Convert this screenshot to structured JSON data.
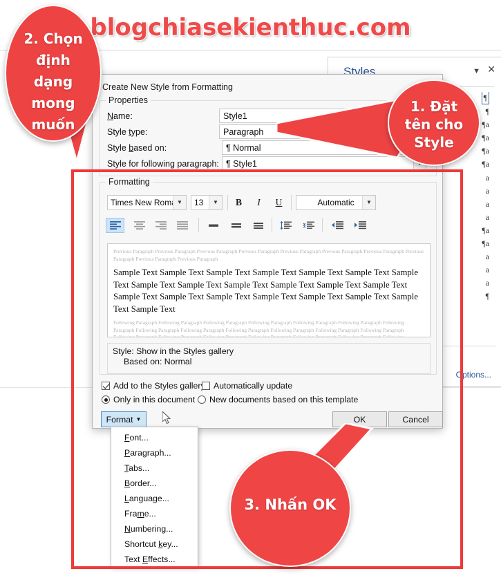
{
  "watermark": "blogchiasekienthuc.com",
  "styles_pane": {
    "title": "Styles",
    "caret_icon": "chevron-down-icon",
    "close_icon": "close-icon",
    "options_label": "Options...",
    "items": [
      {
        "mark": "¶",
        "selected": true
      },
      {
        "mark": "¶",
        "selected": false
      },
      {
        "mark": "¶a",
        "selected": false
      },
      {
        "mark": "¶a",
        "selected": false
      },
      {
        "mark": "¶a",
        "selected": false
      },
      {
        "mark": "¶a",
        "selected": false
      },
      {
        "mark": "a",
        "selected": false
      },
      {
        "mark": "a",
        "selected": false
      },
      {
        "mark": "a",
        "selected": false
      },
      {
        "mark": "a",
        "selected": false
      },
      {
        "mark": "¶a",
        "selected": false
      },
      {
        "mark": "¶a",
        "selected": false
      },
      {
        "mark": "a",
        "selected": false
      },
      {
        "mark": "a",
        "selected": false
      },
      {
        "mark": "a",
        "selected": false
      },
      {
        "mark": "¶",
        "selected": false
      }
    ]
  },
  "dialog": {
    "title": "Create New Style from Formatting",
    "close_icon": "close-icon",
    "properties": {
      "legend": "Properties",
      "name_label": "Name:",
      "name_value": "Style1",
      "style_type_label": "Style type:",
      "style_type_value": "Paragraph",
      "style_based_on_label": "Style based on:",
      "style_based_on_value": "¶ Normal",
      "style_following_label": "Style for following paragraph:",
      "style_following_value": "¶ Style1"
    },
    "formatting": {
      "legend": "Formatting",
      "font_family": "Times New Roman",
      "font_size": "13",
      "bold": "B",
      "italic": "I",
      "underline": "U",
      "font_color": "Automatic",
      "align_buttons": [
        "align-left",
        "align-center",
        "align-right",
        "align-justify"
      ],
      "spacing_buttons": [
        "line-spacing-single",
        "line-spacing-1.5",
        "line-spacing-double"
      ],
      "para_spacing_buttons": [
        "increase-paragraph-spacing",
        "decrease-paragraph-spacing"
      ],
      "indent_buttons": [
        "decrease-indent",
        "increase-indent"
      ],
      "preview": {
        "previous_paragraph": "Previous Paragraph Previous Paragraph Previous Paragraph Previous Paragraph Previous Paragraph Previous Paragraph Previous Paragraph Previous Paragraph Previous Paragraph Previous Paragraph",
        "sample_text": "Sample Text Sample Text Sample Text Sample Text Sample Text Sample Text Sample Text Sample Text Sample Text Sample Text Sample Text Sample Text Sample Text Sample Text Sample Text Sample Text Sample Text Sample Text Sample Text Sample Text Sample Text",
        "following_paragraph": "Following Paragraph Following Paragraph Following Paragraph Following Paragraph Following Paragraph Following Paragraph Following Paragraph Following Paragraph Following Paragraph Following Paragraph Following Paragraph Following Paragraph Following Paragraph Following Paragraph Following Paragraph Following Paragraph Following Paragraph Following Paragraph Following Paragraph Following Paragraph"
      },
      "description_line1": "Style: Show in the Styles gallery",
      "description_line2": "Based on: Normal"
    },
    "options": {
      "add_to_gallery_label": "Add to the Styles gallery",
      "add_to_gallery_checked": true,
      "auto_update_label": "Automatically update",
      "auto_update_checked": false,
      "only_this_doc_label": "Only in this document",
      "only_this_doc_selected": true,
      "new_docs_label": "New documents based on this template",
      "new_docs_selected": false
    },
    "buttons": {
      "format_label": "Format",
      "ok_label": "OK",
      "cancel_label": "Cancel"
    }
  },
  "format_menu": {
    "items": [
      "Font...",
      "Paragraph...",
      "Tabs...",
      "Border...",
      "Language...",
      "Frame...",
      "Numbering...",
      "Shortcut key...",
      "Text Effects..."
    ]
  },
  "callouts": {
    "one": [
      "1. Đặt",
      "tên cho",
      "Style"
    ],
    "two": [
      "2. Chọn",
      "định",
      "dạng",
      "mong",
      "muốn"
    ],
    "three": "3. Nhấn OK"
  },
  "colors": {
    "accent_red": "#ee4343",
    "highlight_border": "#ee3a3a",
    "watermark_red": "#ef4a4a",
    "link_blue": "#2b5797",
    "selected_blue": "#cce4f7"
  }
}
